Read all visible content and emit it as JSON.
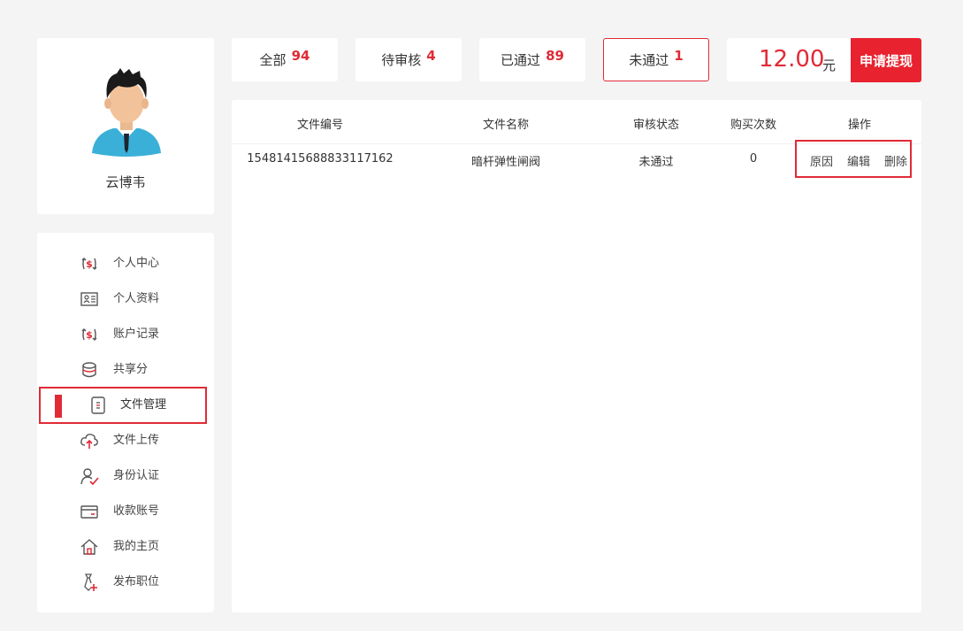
{
  "profile": {
    "username": "云博韦"
  },
  "tabs": [
    {
      "label": "全部",
      "count": "94"
    },
    {
      "label": "待审核",
      "count": "4"
    },
    {
      "label": "已通过",
      "count": "89"
    },
    {
      "label": "未通过",
      "count": "1"
    }
  ],
  "balance": {
    "amount": "12.00",
    "unit": "元",
    "withdraw_label": "申请提现"
  },
  "sidebar": {
    "items": [
      {
        "label": "个人中心",
        "icon": "dollar-cycle-icon"
      },
      {
        "label": "个人资料",
        "icon": "id-card-icon"
      },
      {
        "label": "账户记录",
        "icon": "dollar-cycle-icon"
      },
      {
        "label": "共享分",
        "icon": "database-icon"
      },
      {
        "label": "文件管理",
        "icon": "document-icon"
      },
      {
        "label": "文件上传",
        "icon": "cloud-upload-icon"
      },
      {
        "label": "身份认证",
        "icon": "user-check-icon"
      },
      {
        "label": "收款账号",
        "icon": "card-icon"
      },
      {
        "label": "我的主页",
        "icon": "home-icon"
      },
      {
        "label": "发布职位",
        "icon": "tie-plus-icon"
      }
    ]
  },
  "table": {
    "columns": [
      "文件编号",
      "文件名称",
      "审核状态",
      "购买次数",
      "操作"
    ],
    "rows": [
      {
        "file_no": "15481415688833117162",
        "file_name": "暗杆弹性闸阀",
        "status": "未通过",
        "purchases": "0",
        "actions": [
          "原因",
          "编辑",
          "删除"
        ]
      }
    ]
  },
  "colors": {
    "accent": "#e02b36",
    "background": "#f4f4f4",
    "card": "#ffffff"
  }
}
